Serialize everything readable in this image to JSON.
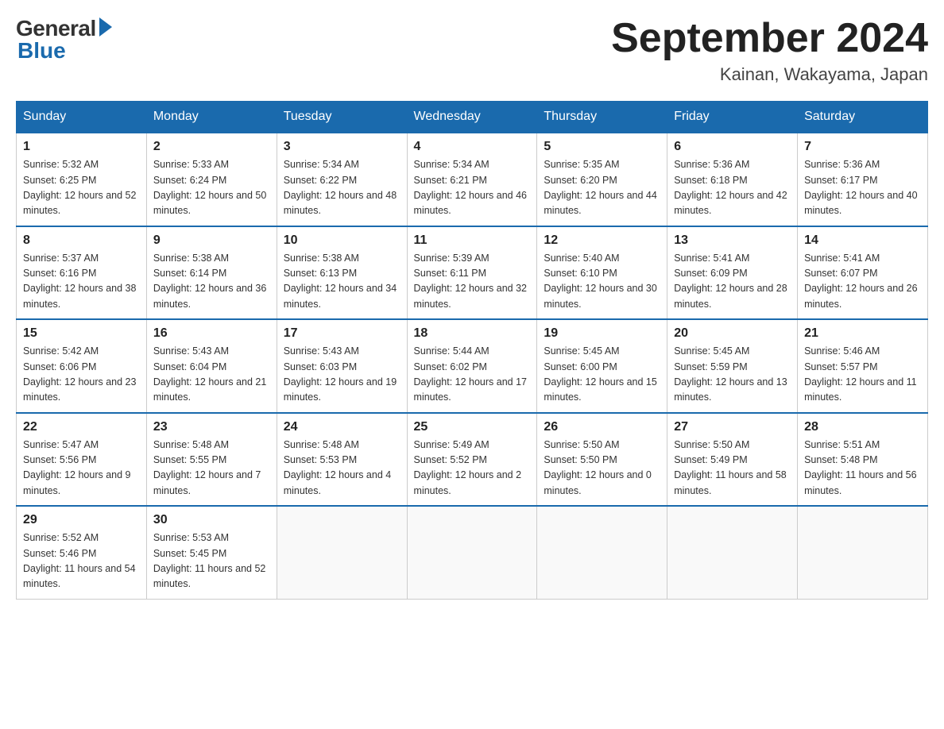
{
  "logo": {
    "general": "General",
    "blue": "Blue"
  },
  "title": {
    "month": "September 2024",
    "location": "Kainan, Wakayama, Japan"
  },
  "weekdays": [
    "Sunday",
    "Monday",
    "Tuesday",
    "Wednesday",
    "Thursday",
    "Friday",
    "Saturday"
  ],
  "weeks": [
    [
      {
        "day": "1",
        "sunrise": "Sunrise: 5:32 AM",
        "sunset": "Sunset: 6:25 PM",
        "daylight": "Daylight: 12 hours and 52 minutes."
      },
      {
        "day": "2",
        "sunrise": "Sunrise: 5:33 AM",
        "sunset": "Sunset: 6:24 PM",
        "daylight": "Daylight: 12 hours and 50 minutes."
      },
      {
        "day": "3",
        "sunrise": "Sunrise: 5:34 AM",
        "sunset": "Sunset: 6:22 PM",
        "daylight": "Daylight: 12 hours and 48 minutes."
      },
      {
        "day": "4",
        "sunrise": "Sunrise: 5:34 AM",
        "sunset": "Sunset: 6:21 PM",
        "daylight": "Daylight: 12 hours and 46 minutes."
      },
      {
        "day": "5",
        "sunrise": "Sunrise: 5:35 AM",
        "sunset": "Sunset: 6:20 PM",
        "daylight": "Daylight: 12 hours and 44 minutes."
      },
      {
        "day": "6",
        "sunrise": "Sunrise: 5:36 AM",
        "sunset": "Sunset: 6:18 PM",
        "daylight": "Daylight: 12 hours and 42 minutes."
      },
      {
        "day": "7",
        "sunrise": "Sunrise: 5:36 AM",
        "sunset": "Sunset: 6:17 PM",
        "daylight": "Daylight: 12 hours and 40 minutes."
      }
    ],
    [
      {
        "day": "8",
        "sunrise": "Sunrise: 5:37 AM",
        "sunset": "Sunset: 6:16 PM",
        "daylight": "Daylight: 12 hours and 38 minutes."
      },
      {
        "day": "9",
        "sunrise": "Sunrise: 5:38 AM",
        "sunset": "Sunset: 6:14 PM",
        "daylight": "Daylight: 12 hours and 36 minutes."
      },
      {
        "day": "10",
        "sunrise": "Sunrise: 5:38 AM",
        "sunset": "Sunset: 6:13 PM",
        "daylight": "Daylight: 12 hours and 34 minutes."
      },
      {
        "day": "11",
        "sunrise": "Sunrise: 5:39 AM",
        "sunset": "Sunset: 6:11 PM",
        "daylight": "Daylight: 12 hours and 32 minutes."
      },
      {
        "day": "12",
        "sunrise": "Sunrise: 5:40 AM",
        "sunset": "Sunset: 6:10 PM",
        "daylight": "Daylight: 12 hours and 30 minutes."
      },
      {
        "day": "13",
        "sunrise": "Sunrise: 5:41 AM",
        "sunset": "Sunset: 6:09 PM",
        "daylight": "Daylight: 12 hours and 28 minutes."
      },
      {
        "day": "14",
        "sunrise": "Sunrise: 5:41 AM",
        "sunset": "Sunset: 6:07 PM",
        "daylight": "Daylight: 12 hours and 26 minutes."
      }
    ],
    [
      {
        "day": "15",
        "sunrise": "Sunrise: 5:42 AM",
        "sunset": "Sunset: 6:06 PM",
        "daylight": "Daylight: 12 hours and 23 minutes."
      },
      {
        "day": "16",
        "sunrise": "Sunrise: 5:43 AM",
        "sunset": "Sunset: 6:04 PM",
        "daylight": "Daylight: 12 hours and 21 minutes."
      },
      {
        "day": "17",
        "sunrise": "Sunrise: 5:43 AM",
        "sunset": "Sunset: 6:03 PM",
        "daylight": "Daylight: 12 hours and 19 minutes."
      },
      {
        "day": "18",
        "sunrise": "Sunrise: 5:44 AM",
        "sunset": "Sunset: 6:02 PM",
        "daylight": "Daylight: 12 hours and 17 minutes."
      },
      {
        "day": "19",
        "sunrise": "Sunrise: 5:45 AM",
        "sunset": "Sunset: 6:00 PM",
        "daylight": "Daylight: 12 hours and 15 minutes."
      },
      {
        "day": "20",
        "sunrise": "Sunrise: 5:45 AM",
        "sunset": "Sunset: 5:59 PM",
        "daylight": "Daylight: 12 hours and 13 minutes."
      },
      {
        "day": "21",
        "sunrise": "Sunrise: 5:46 AM",
        "sunset": "Sunset: 5:57 PM",
        "daylight": "Daylight: 12 hours and 11 minutes."
      }
    ],
    [
      {
        "day": "22",
        "sunrise": "Sunrise: 5:47 AM",
        "sunset": "Sunset: 5:56 PM",
        "daylight": "Daylight: 12 hours and 9 minutes."
      },
      {
        "day": "23",
        "sunrise": "Sunrise: 5:48 AM",
        "sunset": "Sunset: 5:55 PM",
        "daylight": "Daylight: 12 hours and 7 minutes."
      },
      {
        "day": "24",
        "sunrise": "Sunrise: 5:48 AM",
        "sunset": "Sunset: 5:53 PM",
        "daylight": "Daylight: 12 hours and 4 minutes."
      },
      {
        "day": "25",
        "sunrise": "Sunrise: 5:49 AM",
        "sunset": "Sunset: 5:52 PM",
        "daylight": "Daylight: 12 hours and 2 minutes."
      },
      {
        "day": "26",
        "sunrise": "Sunrise: 5:50 AM",
        "sunset": "Sunset: 5:50 PM",
        "daylight": "Daylight: 12 hours and 0 minutes."
      },
      {
        "day": "27",
        "sunrise": "Sunrise: 5:50 AM",
        "sunset": "Sunset: 5:49 PM",
        "daylight": "Daylight: 11 hours and 58 minutes."
      },
      {
        "day": "28",
        "sunrise": "Sunrise: 5:51 AM",
        "sunset": "Sunset: 5:48 PM",
        "daylight": "Daylight: 11 hours and 56 minutes."
      }
    ],
    [
      {
        "day": "29",
        "sunrise": "Sunrise: 5:52 AM",
        "sunset": "Sunset: 5:46 PM",
        "daylight": "Daylight: 11 hours and 54 minutes."
      },
      {
        "day": "30",
        "sunrise": "Sunrise: 5:53 AM",
        "sunset": "Sunset: 5:45 PM",
        "daylight": "Daylight: 11 hours and 52 minutes."
      },
      null,
      null,
      null,
      null,
      null
    ]
  ]
}
